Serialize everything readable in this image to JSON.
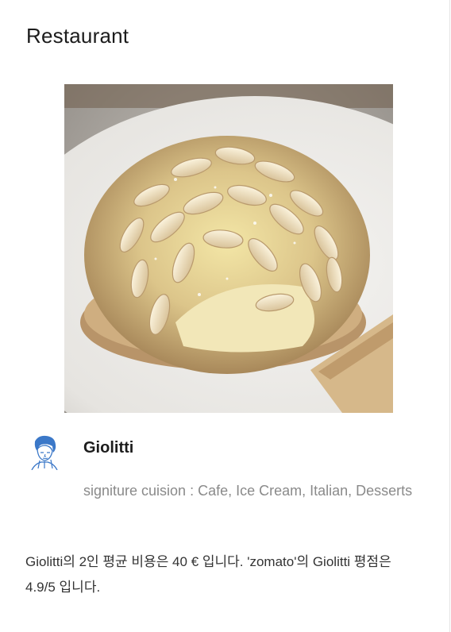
{
  "page": {
    "title": "Restaurant"
  },
  "restaurant": {
    "name": "Giolitti",
    "cuisine_text": "signiture cuision : Cafe, Ice Cream, Italian, Desserts",
    "description": "Giolitti의 2인 평균 비용은 40 € 입니다. 'zomato'의 Giolitti 평점은 4.9/5 입니다."
  },
  "images": {
    "photo_icon": "pastry-photo",
    "avatar_icon": "author-avatar-icon"
  },
  "colors": {
    "text_primary": "#1c1c1c",
    "text_secondary": "#8a8a8a",
    "text_body": "#333333",
    "divider": "#e4e4e4",
    "avatar_blue": "#3b78c8"
  }
}
